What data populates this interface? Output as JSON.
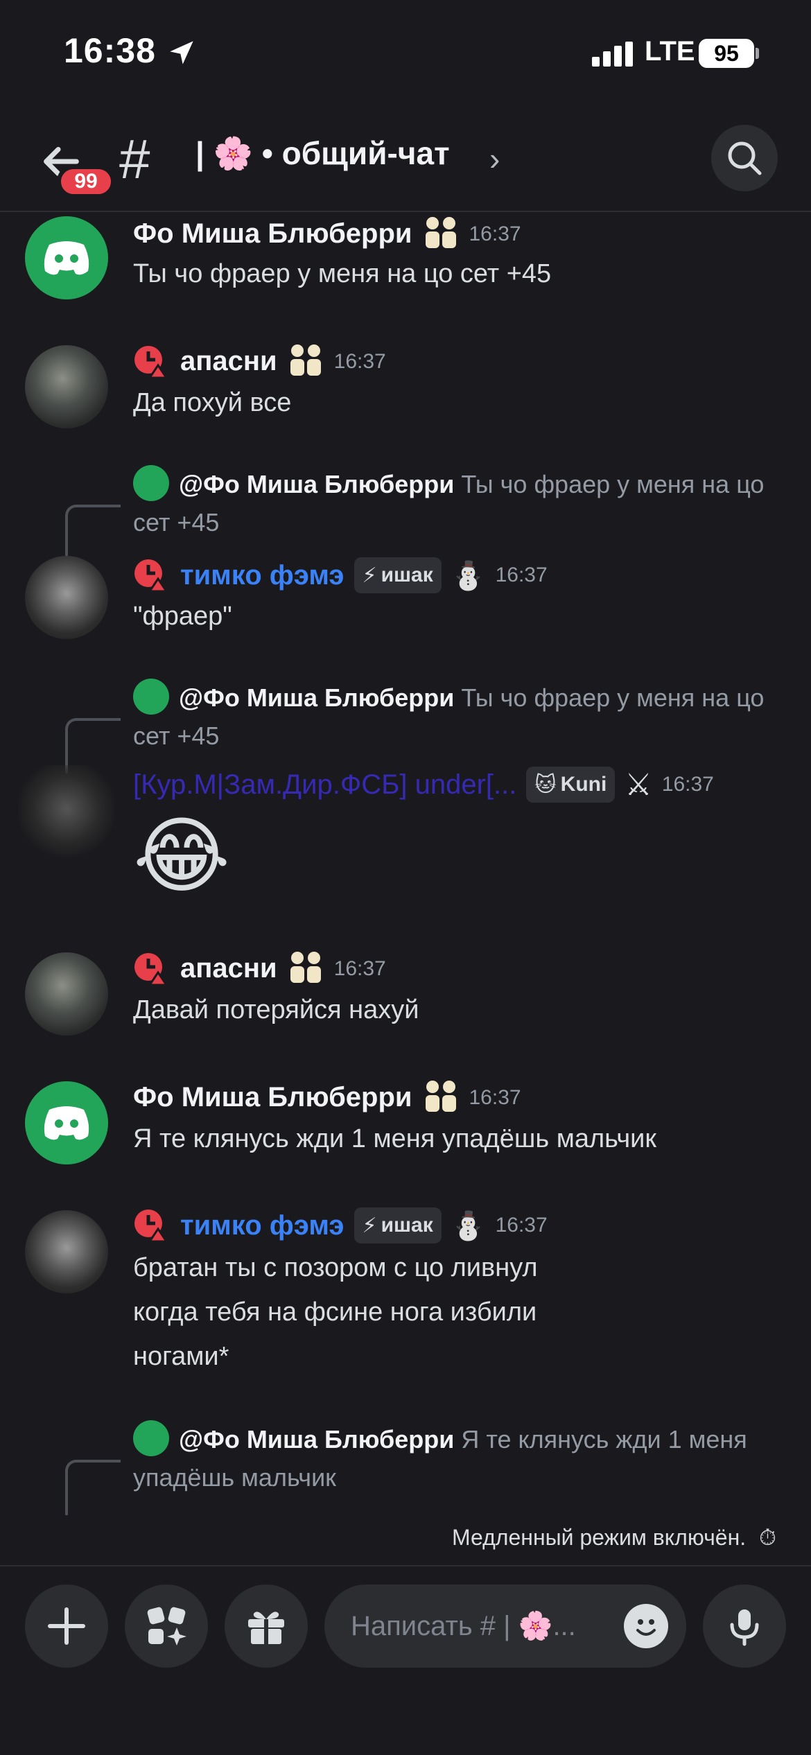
{
  "status": {
    "time": "16:38",
    "network": "LTE",
    "battery": "95"
  },
  "header": {
    "unread_badge": "99",
    "channel_title": "| 🌸 • общий-чат",
    "chevron": "›",
    "icons": [
      "back-arrow-icon",
      "hash-icon",
      "search-icon"
    ]
  },
  "messages": [
    {
      "author": "Фо Миша Блюберри",
      "time": "16:37",
      "text": "Ты чо фраер у меня на цо сет +45"
    },
    {
      "author": "апасни",
      "time": "16:37",
      "text": "Да похуй все"
    },
    {
      "reply_to": "@Фо Миша Блюберри",
      "reply_text": "Ты чо фраер у меня на цо сет +45",
      "author": "тимко фэмэ",
      "tag": "ишак",
      "time": "16:37",
      "text": "\"фраер\""
    },
    {
      "reply_to": "@Фо Миша Блюберри",
      "reply_text": "Ты чо фраер у меня на цо сет +45",
      "author": "[Кур.М|Зам.Дир.ФСБ] under[...",
      "tag": "Kuni",
      "time": "16:37",
      "text": "😂"
    },
    {
      "author": "апасни",
      "time": "16:37",
      "text": "Давай потеряйся нахуй"
    },
    {
      "author": "Фо Миша Блюберри",
      "time": "16:37",
      "text": "Я те клянусь жди 1 меня упадёшь мальчик"
    },
    {
      "author": "тимко фэмэ",
      "tag": "ишак",
      "time": "16:37",
      "lines": [
        "братан ты с позором с цо ливнул",
        "когда тебя на фсине нога избили",
        "ногами*"
      ]
    },
    {
      "reply_to": "@Фо Миша Блюберри",
      "reply_text": "Я те клянусь жди 1 меня упадёшь мальчик"
    }
  ],
  "slow_mode": "Медленный режим включён.",
  "composer": {
    "placeholder": "Написать # | 🌸..."
  },
  "colors": {
    "bg": "#1a1a1e",
    "green": "#23a559",
    "blue_name": "#3b82f6",
    "badge_red": "#e8404a"
  }
}
